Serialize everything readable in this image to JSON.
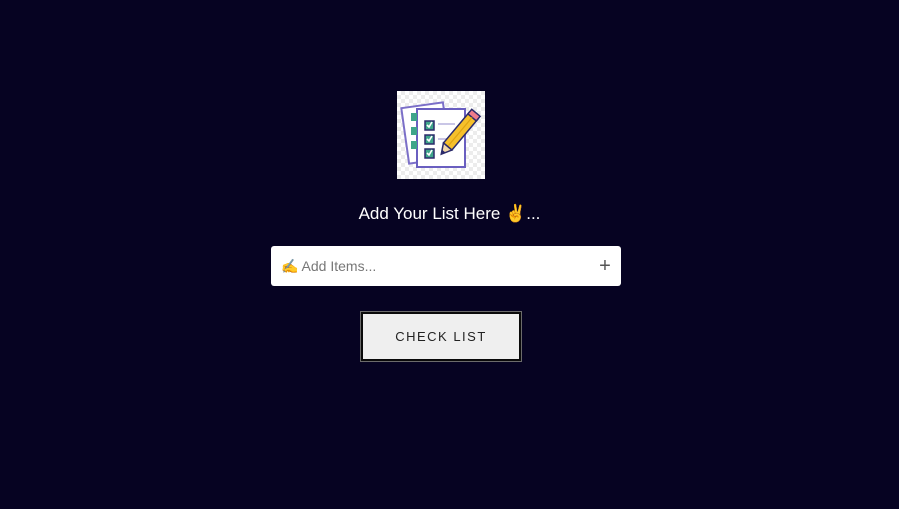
{
  "logo": {
    "icon": "checklist-pencil-icon"
  },
  "heading": {
    "text": "Add Your List Here ✌️..."
  },
  "input": {
    "placeholder": "✍️ Add Items...",
    "value": ""
  },
  "add_button": {
    "label": "+"
  },
  "check_list_button": {
    "label": "CHECK LIST"
  },
  "colors": {
    "background": "#060322",
    "input_background": "#ffffff",
    "button_background": "#efefef"
  }
}
